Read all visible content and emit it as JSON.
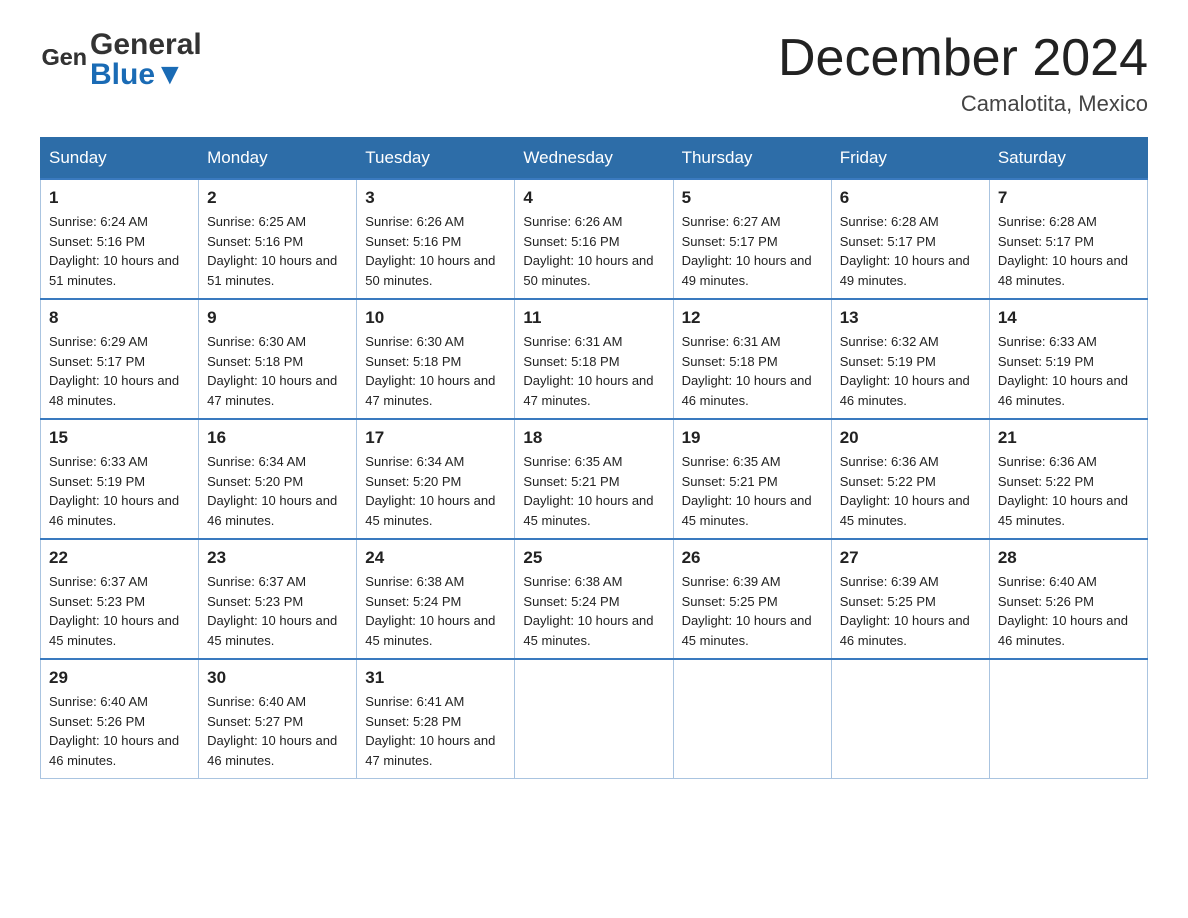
{
  "header": {
    "logo_general": "General",
    "logo_blue": "Blue",
    "title": "December 2024",
    "subtitle": "Camalotita, Mexico"
  },
  "days_of_week": [
    "Sunday",
    "Monday",
    "Tuesday",
    "Wednesday",
    "Thursday",
    "Friday",
    "Saturday"
  ],
  "weeks": [
    [
      {
        "day": "1",
        "sunrise": "6:24 AM",
        "sunset": "5:16 PM",
        "daylight": "10 hours and 51 minutes."
      },
      {
        "day": "2",
        "sunrise": "6:25 AM",
        "sunset": "5:16 PM",
        "daylight": "10 hours and 51 minutes."
      },
      {
        "day": "3",
        "sunrise": "6:26 AM",
        "sunset": "5:16 PM",
        "daylight": "10 hours and 50 minutes."
      },
      {
        "day": "4",
        "sunrise": "6:26 AM",
        "sunset": "5:16 PM",
        "daylight": "10 hours and 50 minutes."
      },
      {
        "day": "5",
        "sunrise": "6:27 AM",
        "sunset": "5:17 PM",
        "daylight": "10 hours and 49 minutes."
      },
      {
        "day": "6",
        "sunrise": "6:28 AM",
        "sunset": "5:17 PM",
        "daylight": "10 hours and 49 minutes."
      },
      {
        "day": "7",
        "sunrise": "6:28 AM",
        "sunset": "5:17 PM",
        "daylight": "10 hours and 48 minutes."
      }
    ],
    [
      {
        "day": "8",
        "sunrise": "6:29 AM",
        "sunset": "5:17 PM",
        "daylight": "10 hours and 48 minutes."
      },
      {
        "day": "9",
        "sunrise": "6:30 AM",
        "sunset": "5:18 PM",
        "daylight": "10 hours and 47 minutes."
      },
      {
        "day": "10",
        "sunrise": "6:30 AM",
        "sunset": "5:18 PM",
        "daylight": "10 hours and 47 minutes."
      },
      {
        "day": "11",
        "sunrise": "6:31 AM",
        "sunset": "5:18 PM",
        "daylight": "10 hours and 47 minutes."
      },
      {
        "day": "12",
        "sunrise": "6:31 AM",
        "sunset": "5:18 PM",
        "daylight": "10 hours and 46 minutes."
      },
      {
        "day": "13",
        "sunrise": "6:32 AM",
        "sunset": "5:19 PM",
        "daylight": "10 hours and 46 minutes."
      },
      {
        "day": "14",
        "sunrise": "6:33 AM",
        "sunset": "5:19 PM",
        "daylight": "10 hours and 46 minutes."
      }
    ],
    [
      {
        "day": "15",
        "sunrise": "6:33 AM",
        "sunset": "5:19 PM",
        "daylight": "10 hours and 46 minutes."
      },
      {
        "day": "16",
        "sunrise": "6:34 AM",
        "sunset": "5:20 PM",
        "daylight": "10 hours and 46 minutes."
      },
      {
        "day": "17",
        "sunrise": "6:34 AM",
        "sunset": "5:20 PM",
        "daylight": "10 hours and 45 minutes."
      },
      {
        "day": "18",
        "sunrise": "6:35 AM",
        "sunset": "5:21 PM",
        "daylight": "10 hours and 45 minutes."
      },
      {
        "day": "19",
        "sunrise": "6:35 AM",
        "sunset": "5:21 PM",
        "daylight": "10 hours and 45 minutes."
      },
      {
        "day": "20",
        "sunrise": "6:36 AM",
        "sunset": "5:22 PM",
        "daylight": "10 hours and 45 minutes."
      },
      {
        "day": "21",
        "sunrise": "6:36 AM",
        "sunset": "5:22 PM",
        "daylight": "10 hours and 45 minutes."
      }
    ],
    [
      {
        "day": "22",
        "sunrise": "6:37 AM",
        "sunset": "5:23 PM",
        "daylight": "10 hours and 45 minutes."
      },
      {
        "day": "23",
        "sunrise": "6:37 AM",
        "sunset": "5:23 PM",
        "daylight": "10 hours and 45 minutes."
      },
      {
        "day": "24",
        "sunrise": "6:38 AM",
        "sunset": "5:24 PM",
        "daylight": "10 hours and 45 minutes."
      },
      {
        "day": "25",
        "sunrise": "6:38 AM",
        "sunset": "5:24 PM",
        "daylight": "10 hours and 45 minutes."
      },
      {
        "day": "26",
        "sunrise": "6:39 AM",
        "sunset": "5:25 PM",
        "daylight": "10 hours and 45 minutes."
      },
      {
        "day": "27",
        "sunrise": "6:39 AM",
        "sunset": "5:25 PM",
        "daylight": "10 hours and 46 minutes."
      },
      {
        "day": "28",
        "sunrise": "6:40 AM",
        "sunset": "5:26 PM",
        "daylight": "10 hours and 46 minutes."
      }
    ],
    [
      {
        "day": "29",
        "sunrise": "6:40 AM",
        "sunset": "5:26 PM",
        "daylight": "10 hours and 46 minutes."
      },
      {
        "day": "30",
        "sunrise": "6:40 AM",
        "sunset": "5:27 PM",
        "daylight": "10 hours and 46 minutes."
      },
      {
        "day": "31",
        "sunrise": "6:41 AM",
        "sunset": "5:28 PM",
        "daylight": "10 hours and 47 minutes."
      },
      null,
      null,
      null,
      null
    ]
  ]
}
